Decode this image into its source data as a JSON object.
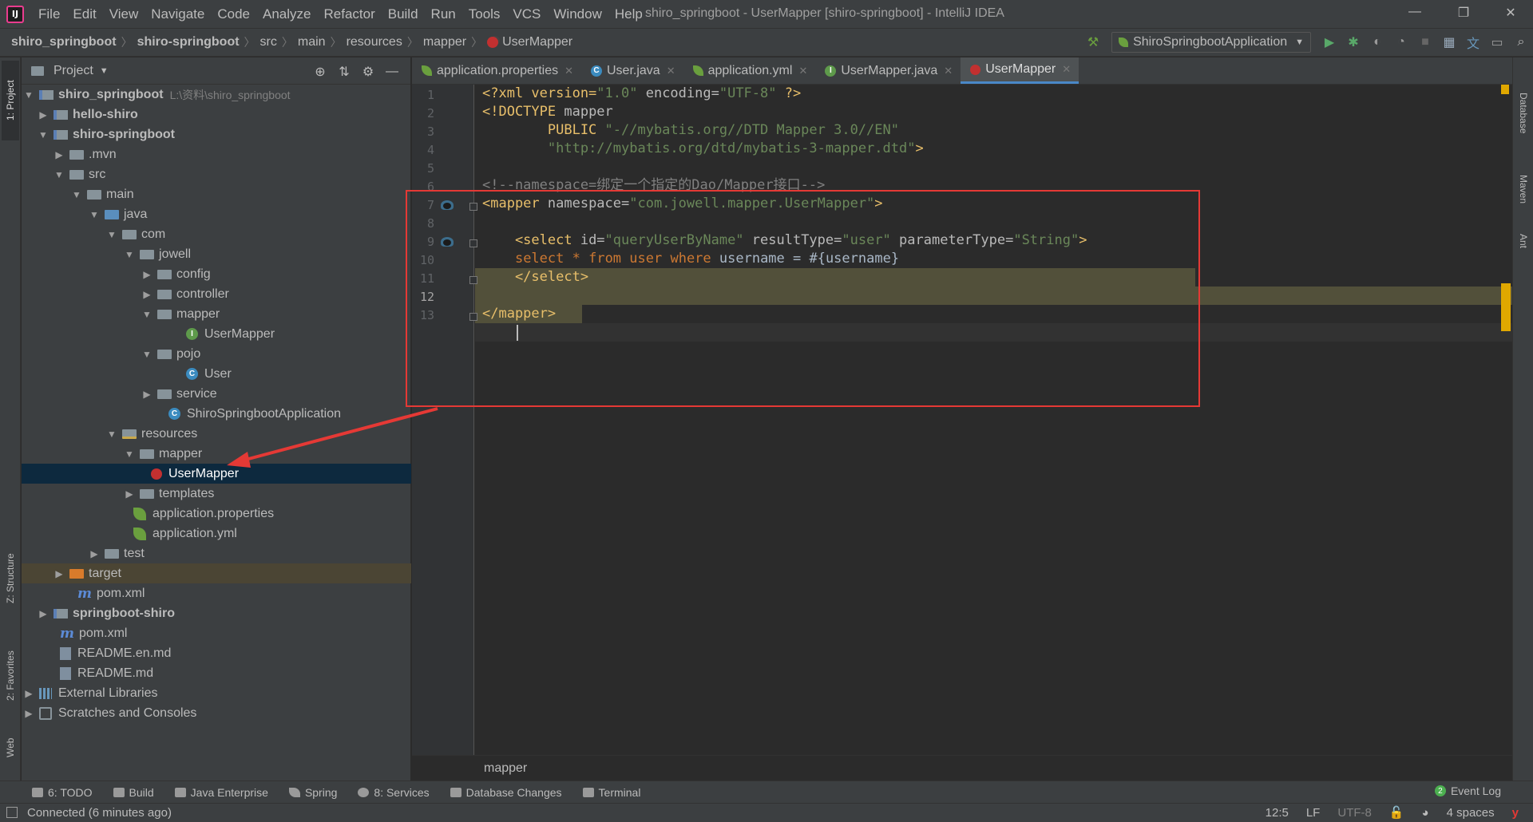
{
  "menu": {
    "items": [
      "File",
      "Edit",
      "View",
      "Navigate",
      "Code",
      "Analyze",
      "Refactor",
      "Build",
      "Run",
      "Tools",
      "VCS",
      "Window",
      "Help"
    ],
    "window_title": "shiro_springboot - UserMapper [shiro-springboot] - IntelliJ IDEA"
  },
  "navbar": {
    "crumbs": [
      "shiro_springboot",
      "shiro-springboot",
      "src",
      "main",
      "resources",
      "mapper",
      "UserMapper"
    ],
    "run_config": "ShiroSpringbootApplication"
  },
  "project_panel": {
    "title": "Project",
    "tree": [
      {
        "label": "shiro_springboot",
        "sub": "L:\\资料\\shiro_springboot",
        "icon": "module-folder-icon",
        "bold": true
      },
      {
        "label": "hello-shiro",
        "icon": "module-folder-icon",
        "bold": true
      },
      {
        "label": "shiro-springboot",
        "icon": "module-folder-icon",
        "bold": true
      },
      {
        "label": ".mvn",
        "icon": "folder-icon"
      },
      {
        "label": "src",
        "icon": "folder-icon"
      },
      {
        "label": "main",
        "icon": "folder-icon"
      },
      {
        "label": "java",
        "icon": "source-folder-icon"
      },
      {
        "label": "com",
        "icon": "package-icon"
      },
      {
        "label": "jowell",
        "icon": "package-icon"
      },
      {
        "label": "config",
        "icon": "package-icon"
      },
      {
        "label": "controller",
        "icon": "package-icon"
      },
      {
        "label": "mapper",
        "icon": "package-icon"
      },
      {
        "label": "UserMapper",
        "icon": "interface-icon"
      },
      {
        "label": "pojo",
        "icon": "package-icon"
      },
      {
        "label": "User",
        "icon": "class-icon"
      },
      {
        "label": "service",
        "icon": "package-icon"
      },
      {
        "label": "ShiroSpringbootApplication",
        "icon": "spring-boot-class-icon"
      },
      {
        "label": "resources",
        "icon": "resources-folder-icon"
      },
      {
        "label": "mapper",
        "icon": "folder-icon"
      },
      {
        "label": "UserMapper",
        "icon": "mybatis-xml-icon"
      },
      {
        "label": "templates",
        "icon": "folder-icon"
      },
      {
        "label": "application.properties",
        "icon": "spring-config-icon"
      },
      {
        "label": "application.yml",
        "icon": "spring-config-icon"
      },
      {
        "label": "test",
        "icon": "folder-icon"
      },
      {
        "label": "target",
        "icon": "excluded-folder-icon"
      },
      {
        "label": "pom.xml",
        "icon": "maven-icon"
      },
      {
        "label": "springboot-shiro",
        "icon": "module-folder-icon",
        "bold": true
      },
      {
        "label": "pom.xml",
        "icon": "maven-icon"
      },
      {
        "label": "README.en.md",
        "icon": "markdown-icon"
      },
      {
        "label": "README.md",
        "icon": "markdown-icon"
      },
      {
        "label": "External Libraries",
        "icon": "library-icon"
      },
      {
        "label": "Scratches and Consoles",
        "icon": "scratch-icon"
      }
    ]
  },
  "editor_tabs": [
    {
      "label": "application.properties",
      "icon": "spring-config-icon"
    },
    {
      "label": "User.java",
      "icon": "class-icon"
    },
    {
      "label": "application.yml",
      "icon": "spring-config-icon"
    },
    {
      "label": "UserMapper.java",
      "icon": "interface-icon"
    },
    {
      "label": "UserMapper",
      "icon": "mybatis-xml-icon",
      "active": true
    }
  ],
  "editor": {
    "line_numbers": [
      "1",
      "2",
      "3",
      "4",
      "5",
      "6",
      "7",
      "8",
      "9",
      "10",
      "11",
      "12",
      "13"
    ],
    "code": {
      "l1_a": "<?xml version=",
      "l1_b": "\"1.0\"",
      "l1_c": " encoding=",
      "l1_d": "\"UTF-8\"",
      "l1_e": " ?>",
      "l2_a": "<!DOCTYPE ",
      "l2_b": "mapper",
      "l3_a": "        PUBLIC ",
      "l3_b": "\"-//mybatis.org//DTD Mapper 3.0//EN\"",
      "l4_a": "        ",
      "l4_b": "\"http://mybatis.org/dtd/mybatis-3-mapper.dtd\"",
      "l4_c": ">",
      "l6": "<!--namespace=绑定一个指定的Dao/Mapper接口-->",
      "l7_a": "<mapper ",
      "l7_b": "namespace=",
      "l7_c": "\"com.jowell.mapper.UserMapper\"",
      "l7_d": ">",
      "l9_a": "    <select ",
      "l9_b": "id=",
      "l9_c": "\"queryUserByName\"",
      "l9_d": " resultType=",
      "l9_e": "\"user\"",
      "l9_f": " parameterType=",
      "l9_g": "\"String\"",
      "l9_h": ">",
      "l10_a": "    ",
      "l10_b": "select",
      "l10_c": " * ",
      "l10_d": "from",
      "l10_e": " user ",
      "l10_f": "where",
      "l10_g": " username = #{username}",
      "l11": "    </select>",
      "l13": "</mapper>"
    },
    "footer_breadcrumb": "mapper"
  },
  "left_stripe": [
    "1: Project",
    "Z: Structure",
    "2: Favorites",
    "Web"
  ],
  "right_stripe": [
    "Database",
    "Maven",
    "Ant"
  ],
  "bottom_tools": [
    {
      "label": "6: TODO",
      "icon": "todo-icon"
    },
    {
      "label": "Build",
      "icon": "hammer-icon"
    },
    {
      "label": "Java Enterprise",
      "icon": "java-enterprise-icon"
    },
    {
      "label": "Spring",
      "icon": "spring-icon"
    },
    {
      "label": "8: Services",
      "icon": "services-icon"
    },
    {
      "label": "Database Changes",
      "icon": "database-changes-icon"
    },
    {
      "label": "Terminal",
      "icon": "terminal-icon"
    }
  ],
  "event_log": {
    "label": "Event Log",
    "count": "2"
  },
  "status": {
    "message": "Connected (6 minutes ago)",
    "position": "12:5",
    "line_sep": "LF",
    "encoding": "UTF-8",
    "indent": "4 spaces"
  },
  "colors": {
    "annotation_red": "#e53935",
    "selection": "#0d293e",
    "highlight_yellow": "#52503a"
  }
}
